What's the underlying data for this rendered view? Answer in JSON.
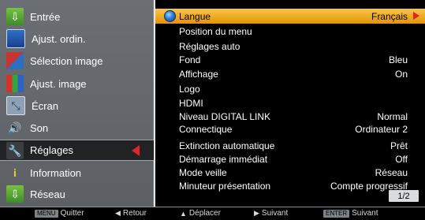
{
  "left_menu": {
    "items": [
      {
        "label": "Entrée",
        "icon": "input-icon"
      },
      {
        "label": "Ajust. ordin.",
        "icon": "computer-adjust-icon"
      },
      {
        "label": "Sélection image",
        "icon": "image-select-icon"
      },
      {
        "label": "Ajust. image",
        "icon": "image-adjust-icon"
      },
      {
        "label": "Écran",
        "icon": "screen-icon"
      },
      {
        "label": "Son",
        "icon": "sound-icon"
      },
      {
        "label": "Réglages",
        "icon": "settings-icon"
      },
      {
        "label": "Information",
        "icon": "info-icon"
      },
      {
        "label": "Réseau",
        "icon": "network-icon"
      }
    ],
    "selected_index": 6
  },
  "settings": {
    "rows": [
      {
        "label": "Langue",
        "value": "Français"
      },
      {
        "label": "Position du menu",
        "value": ""
      },
      {
        "label": "Réglages auto",
        "value": ""
      },
      {
        "label": "Fond",
        "value": "Bleu"
      },
      {
        "label": "Affichage",
        "value": "On"
      },
      {
        "label": "Logo",
        "value": ""
      },
      {
        "label": "HDMI",
        "value": ""
      },
      {
        "label": "Niveau DIGITAL LINK",
        "value": "Normal"
      },
      {
        "label": "Connectique",
        "value": "Ordinateur 2"
      },
      {
        "label": "Extinction automatique",
        "value": "Prêt"
      },
      {
        "label": "Démarrage immédiat",
        "value": "Off"
      },
      {
        "label": "Mode veille",
        "value": "Réseau"
      },
      {
        "label": "Minuteur présentation",
        "value": "Compte progressif"
      }
    ],
    "highlighted_index": 0,
    "page_indicator": "1/2"
  },
  "footer": {
    "quit_key": "MENU",
    "quit_label": "Quitter",
    "back_label": "Retour",
    "move_label": "Déplacer",
    "next_label": "Suivant",
    "enter_key": "ENTER",
    "enter_label": "Suivant"
  },
  "colors": {
    "highlight": "#eeaa1f",
    "selected_arrow": "#e3222a",
    "menu_bg": "#5d6166",
    "panel_bg": "#000000"
  }
}
